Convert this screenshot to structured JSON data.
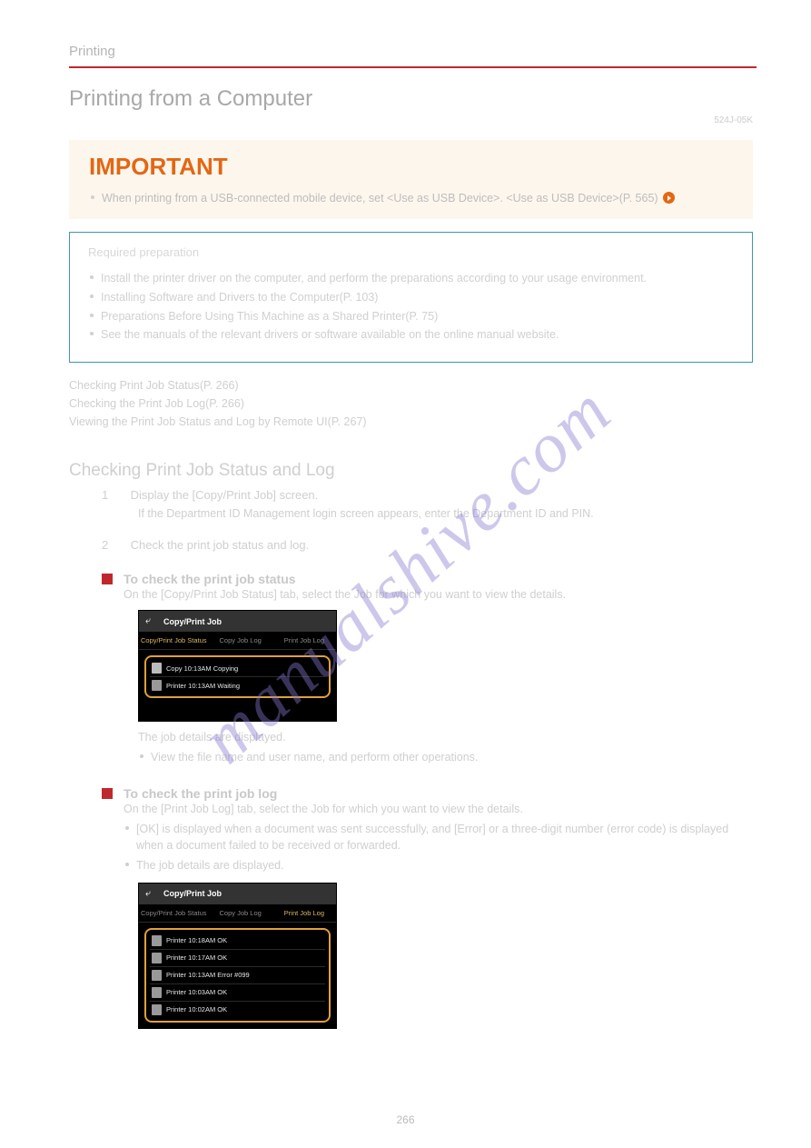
{
  "header": "Printing",
  "title": "Printing from a Computer",
  "rev": "524J-05K",
  "important": {
    "heading": "IMPORTANT",
    "bullet": "When printing from a USB-connected mobile device, set <Use as USB Device>.    <Use as USB Device>(P. 565)"
  },
  "prep": {
    "title": "Required preparation",
    "items": [
      "Install the printer driver on the computer, and perform the preparations according to your usage environment.",
      "Installing Software and Drivers to the Computer(P. 103)",
      "Preparations Before Using This Machine as a Shared Printer(P. 75)",
      "See the manuals of the relevant drivers or software available on the online manual website."
    ]
  },
  "anchors": [
    "Checking Print Job Status(P. 266)",
    "Checking the Print Job Log(P. 266)",
    "Viewing the Print Job Status and Log by Remote UI(P. 267)"
  ],
  "section1": {
    "heading": "Checking Print Job Status and Log",
    "step1": "Display the [Copy/Print Job] screen.",
    "step2": "Check the print job status and log.",
    "note1": "If the Department ID Management login screen appears, enter the Department ID and PIN.",
    "sub1": {
      "title": "To check the print job status",
      "desc": "On the [Copy/Print Job Status] tab, select the Job for which you want to view the details.",
      "detail": "The job details are displayed.",
      "bullet": "View the file name and user name, and perform other operations."
    },
    "sub2": {
      "title": "To check the print job log",
      "desc": "On the [Print Job Log] tab, select the Job for which you want to view the details.",
      "bullet1": "[OK] is displayed when a document was sent successfully, and [Error] or a three-digit number (error code) is displayed when a document failed to be received or forwarded.",
      "bullet2": "The job details are displayed."
    }
  },
  "screenshot1": {
    "title": "Copy/Print Job",
    "tabs": [
      "Copy/Print Job Status",
      "Copy Job Log",
      "Print Job Log"
    ],
    "rows": [
      "Copy 10:13AM Copying",
      "Printer 10:13AM Waiting"
    ]
  },
  "screenshot2": {
    "title": "Copy/Print Job",
    "tabs": [
      "Copy/Print Job Status",
      "Copy Job Log",
      "Print Job Log"
    ],
    "rows": [
      "Printer 10:18AM OK",
      "Printer 10:17AM OK",
      "Printer 10:13AM Error #099",
      "Printer 10:03AM OK",
      "Printer 10:02AM OK"
    ]
  },
  "watermark": "manualshive.com",
  "pageNum": "266"
}
